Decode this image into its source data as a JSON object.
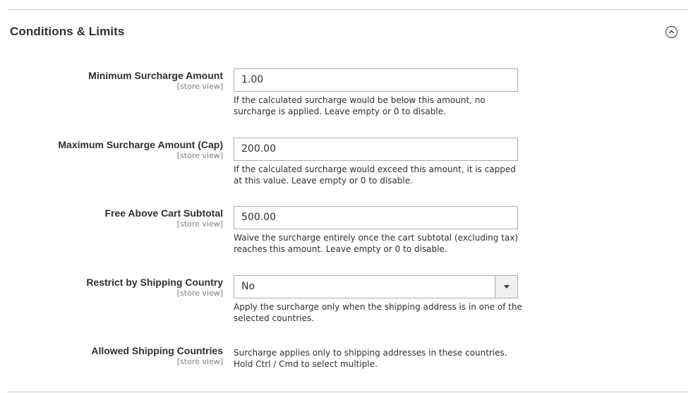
{
  "section": {
    "title": "Conditions & Limits",
    "collapse_icon": "chevron-up-circle-icon"
  },
  "fields": [
    {
      "label": "Minimum Surcharge Amount",
      "scope": "[store view]",
      "value": "1.00",
      "note": "If the calculated surcharge would be below this amount, no surcharge is applied. Leave empty or 0 to disable."
    },
    {
      "label": "Maximum Surcharge Amount (Cap)",
      "scope": "[store view]",
      "value": "200.00",
      "note": "If the calculated surcharge would exceed this amount, it is capped at this value. Leave empty or 0 to disable."
    },
    {
      "label": "Free Above Cart Subtotal",
      "scope": "[store view]",
      "value": "500.00",
      "note": "Waive the surcharge entirely once the cart subtotal (excluding tax) reaches this amount. Leave empty or 0 to disable."
    },
    {
      "label": "Restrict by Shipping Country",
      "scope": "[store view]",
      "value": "No",
      "note": "Apply the surcharge only when the shipping address is in one of the selected countries."
    },
    {
      "label": "Allowed Shipping Countries",
      "scope": "[store view]",
      "note": "Surcharge applies only to shipping addresses in these countries. Hold Ctrl / Cmd to select multiple."
    }
  ]
}
